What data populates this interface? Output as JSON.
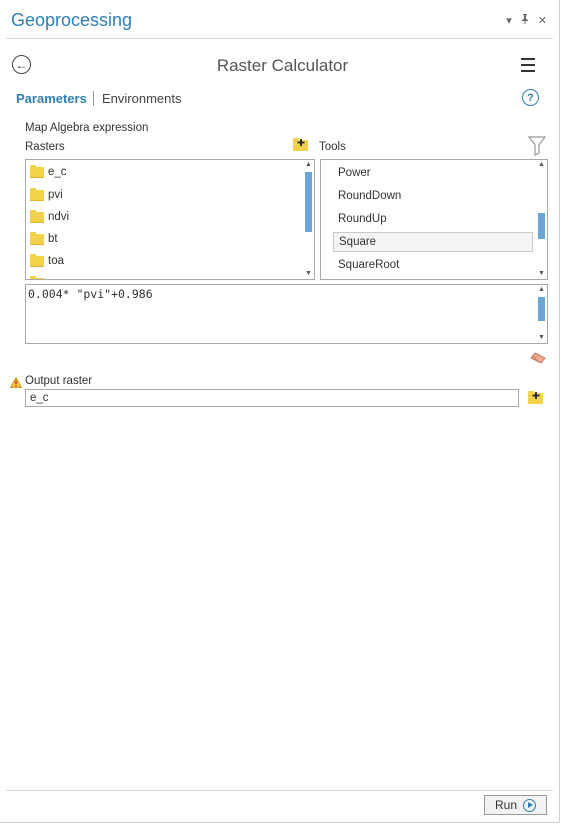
{
  "pane": {
    "title": "Geoprocessing",
    "controls": {
      "dropdown": "▾",
      "pin": "ᵖ",
      "close": "✕"
    }
  },
  "header": {
    "back_icon": "back-arrow-icon",
    "back_glyph": "←",
    "tool_title": "Raster Calculator",
    "menu_icon": "hamburger-menu-icon"
  },
  "tabs": {
    "parameters": "Parameters",
    "environments": "Environments",
    "help_glyph": "?"
  },
  "map_algebra": {
    "label": "Map Algebra expression",
    "rasters_label": "Rasters",
    "tools_label": "Tools",
    "rasters": [
      {
        "label": "e_c"
      },
      {
        "label": "pvi"
      },
      {
        "label": "ndvi"
      },
      {
        "label": "bt"
      },
      {
        "label": "toa"
      }
    ],
    "tools": [
      {
        "label": "Power"
      },
      {
        "label": "RoundDown"
      },
      {
        "label": "RoundUp"
      },
      {
        "label": "Square",
        "selected": true
      },
      {
        "label": "SquareRoot"
      }
    ],
    "expression": "0.004* \"pvi\"+0.986"
  },
  "output": {
    "label": "Output raster",
    "value": "e_c"
  },
  "footer": {
    "run_label": "Run"
  },
  "colors": {
    "accent": "#2f7fb5",
    "folder": "#f2d24a",
    "scroll_thumb": "#6aa6d8"
  }
}
